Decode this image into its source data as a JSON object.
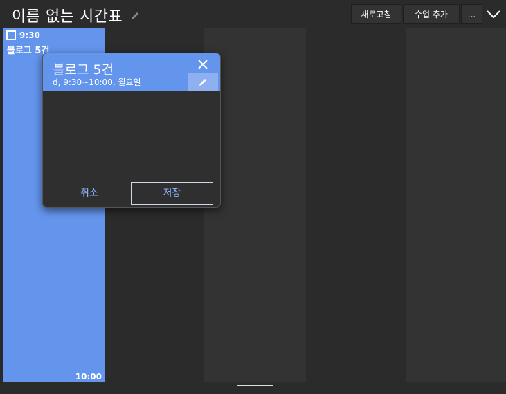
{
  "header": {
    "title": "이름 없는 시간표",
    "refresh_label": "새로고침",
    "add_class_label": "수업 추가",
    "more_label": "...",
    "icons": [
      "pencil-icon",
      "chevron-down-icon"
    ]
  },
  "event": {
    "start_time": "9:30",
    "title": "블로그 5건",
    "end_time": "10:00",
    "color": "#6495ed"
  },
  "popup": {
    "title": "블로그 5건",
    "subtitle": "d, 9:30~10:00, 월요일",
    "cancel_label": "취소",
    "save_label": "저장",
    "accent": "#6495ed"
  },
  "colors": {
    "background": "#2b2b2b",
    "column_a": "#2b2b2b",
    "column_b": "#333333",
    "button_text": "#8ab4f8"
  }
}
